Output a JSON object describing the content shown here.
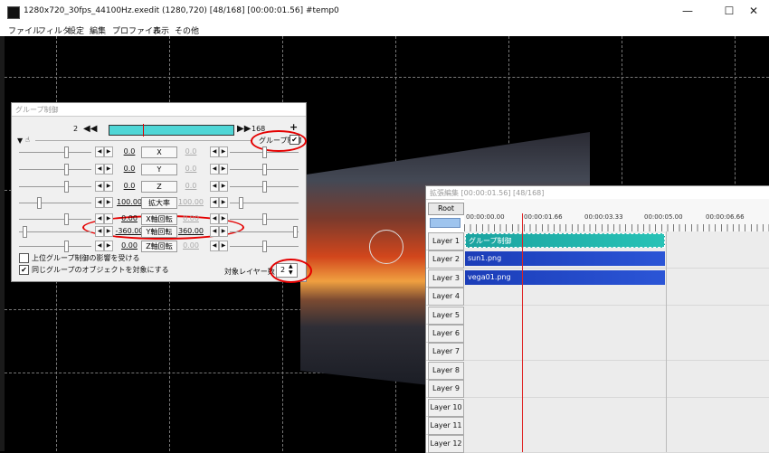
{
  "window": {
    "title": "1280x720_30fps_44100Hz.exedit (1280,720)  [48/168]  [00:00:01.56]  #temp0",
    "minimize": "—",
    "maximize": "☐",
    "close": "✕"
  },
  "menu": [
    "ファイル",
    "フィルタ",
    "設定",
    "編集",
    "プロファイル",
    "表示",
    "その他"
  ],
  "group_dialog": {
    "title": "グループ制御",
    "frame_start": "2",
    "frame_end": "168",
    "plus": "+",
    "group_check_label": "グループ制御",
    "rows": [
      {
        "left": "0.0",
        "button": "X",
        "right": "0.0",
        "right_dim": true
      },
      {
        "left": "0.0",
        "button": "Y",
        "right": "0.0",
        "right_dim": true
      },
      {
        "left": "0.0",
        "button": "Z",
        "right": "0.0",
        "right_dim": true
      },
      {
        "left": "100.00",
        "button": "拡大率",
        "right": "100.00",
        "right_dim": true
      },
      {
        "left": "0.00",
        "button": "X軸回転",
        "right": "0.00",
        "right_dim": true
      },
      {
        "left": "-360.00",
        "button": "Y軸回転",
        "right": "360.00",
        "right_dim": false
      },
      {
        "left": "0.00",
        "button": "Z軸回転",
        "right": "0.00",
        "right_dim": true
      }
    ],
    "opt1": "上位グループ制御の影響を受ける",
    "opt2": "同じグループのオブジェクトを対象にする",
    "target_label": "対象レイヤー数",
    "target_value": "2"
  },
  "exedit": {
    "title": "拡張編集 [00:00:01.56] [48/168]",
    "root": "Root",
    "ticks": [
      "00:00:00.00",
      "00:00:01.66",
      "00:00:03.33",
      "00:00:05.00",
      "00:00:06.66"
    ],
    "layers": [
      "Layer 1",
      "Layer 2",
      "Layer 3",
      "Layer 4",
      "Layer 5",
      "Layer 6",
      "Layer 7",
      "Layer 8",
      "Layer 9",
      "Layer 10",
      "Layer 11",
      "Layer 12"
    ],
    "clips": {
      "group": "グループ制御",
      "sun": "sun1.png",
      "vega": "vega01.png"
    }
  },
  "colors": {
    "highlight": "#e40000",
    "clip_group": "#1aa3a0",
    "clip_image": "#1b3db8",
    "playhead": "#e02020"
  }
}
